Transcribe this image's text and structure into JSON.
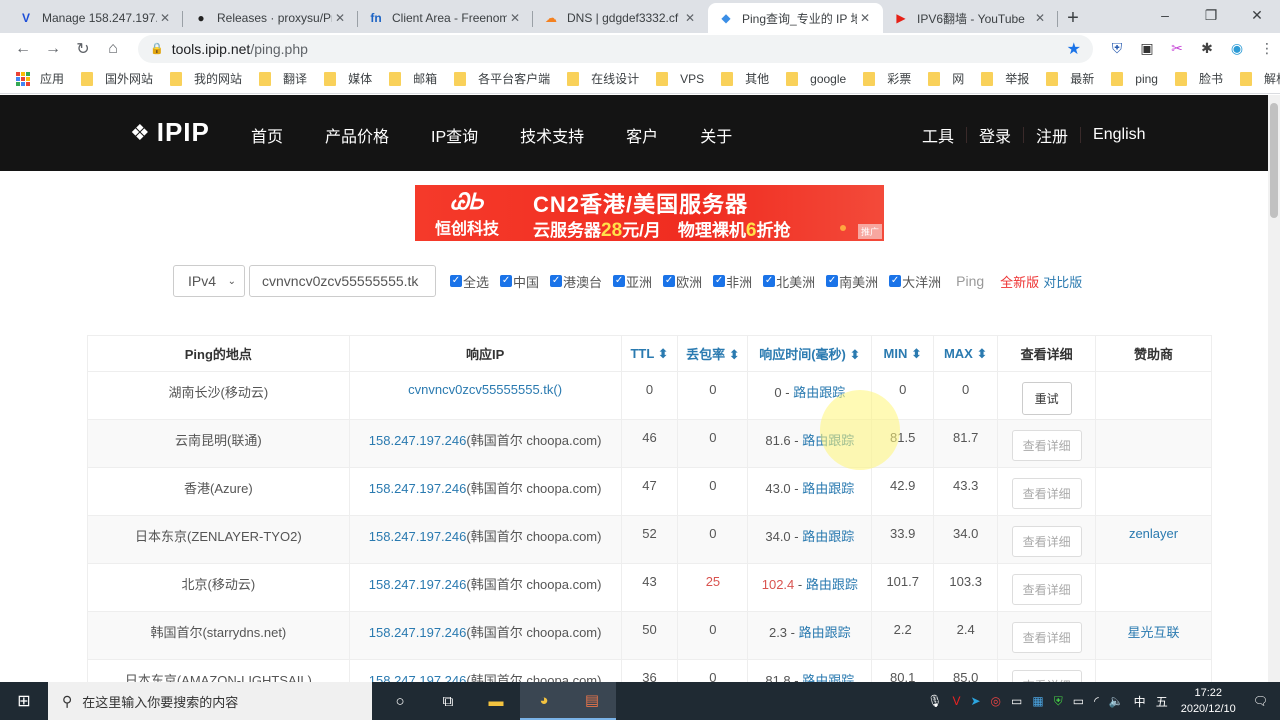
{
  "browser": {
    "tabs": [
      {
        "title": "Manage 158.247.197.",
        "icon": "vultr-icon",
        "glyph": "V",
        "color": "#1e4fd8",
        "active": false
      },
      {
        "title": "Releases · proxysu/Pr",
        "icon": "github-icon",
        "glyph": "●",
        "color": "#222",
        "active": false
      },
      {
        "title": "Client Area - Freenom",
        "icon": "freenom-icon",
        "glyph": "fn",
        "color": "#1c63c4",
        "active": false
      },
      {
        "title": "DNS | gdgdef3332.cf",
        "icon": "cloudflare-icon",
        "glyph": "☁",
        "color": "#f48120",
        "active": false
      },
      {
        "title": "Ping查询_专业的 IP 地",
        "icon": "ipip-icon",
        "glyph": "◆",
        "color": "#3a8ee6",
        "active": true
      },
      {
        "title": "IPV6翻墙 - YouTube",
        "icon": "youtube-icon",
        "glyph": "▶",
        "color": "#e62117",
        "active": false
      }
    ],
    "new_tab": "+",
    "window_controls": {
      "minimize": "–",
      "restore": "❐",
      "close": "✕"
    },
    "url_host": "tools.ipip.net",
    "url_path": "/ping.php",
    "bookmarks": [
      "应用",
      "国外网站",
      "我的网站",
      "翻译",
      "媒体",
      "邮箱",
      "各平台客户端",
      "在线设计",
      "VPS",
      "其他",
      "google",
      "彩票",
      "网",
      "举报",
      "最新",
      "ping",
      "脸书",
      "解析"
    ]
  },
  "site": {
    "logo": "IPIP",
    "nav": [
      "首页",
      "产品价格",
      "IP查询",
      "技术支持",
      "客户",
      "关于"
    ],
    "right_nav": [
      "工具",
      "登录",
      "注册",
      "English"
    ]
  },
  "banner": {
    "brand": "恒创科技",
    "headline": "CN2香港/美国服务器",
    "sub_prefix": "云服务器",
    "price": "28",
    "sub_mid": "元/月　物理裸机",
    "discount": "6",
    "sub_suffix": "折抢",
    "ad_tag": "推广"
  },
  "search": {
    "ip_version": "IPv4",
    "domain": "cvnvncv0zcv55555555.tk",
    "regions": [
      "全选",
      "中国",
      "港澳台",
      "亚洲",
      "欧洲",
      "非洲",
      "北美洲",
      "南美洲",
      "大洋洲"
    ],
    "ping_button": "Ping",
    "new_version": "全新版",
    "compare_version": "对比版"
  },
  "table": {
    "headers": [
      "Ping的地点",
      "响应IP",
      "TTL",
      "丢包率",
      "响应时间(毫秒)",
      "MIN",
      "MAX",
      "查看详细",
      "赞助商"
    ],
    "sort_mark": "⬍",
    "trace_label": "路由跟踪",
    "rows": [
      {
        "location": "湖南长沙(移动云)",
        "ip": "cvnvncv0zcv55555555.tk()",
        "ip_note": "",
        "ttl": "0",
        "loss": "0",
        "time": "0",
        "min": "0",
        "max": "0",
        "action": "重试",
        "sponsor": "",
        "warn": false
      },
      {
        "location": "云南昆明(联通)",
        "ip": "158.247.197.246",
        "ip_note": "(韩国首尔 choopa.com)",
        "ttl": "46",
        "loss": "0",
        "time": "81.6",
        "min": "81.5",
        "max": "81.7",
        "action": "查看详细",
        "sponsor": "",
        "warn": false
      },
      {
        "location": "香港(Azure)",
        "ip": "158.247.197.246",
        "ip_note": "(韩国首尔 choopa.com)",
        "ttl": "47",
        "loss": "0",
        "time": "43.0",
        "min": "42.9",
        "max": "43.3",
        "action": "查看详细",
        "sponsor": "",
        "warn": false
      },
      {
        "location": "日本东京(ZENLAYER-TYO2)",
        "ip": "158.247.197.246",
        "ip_note": "(韩国首尔 choopa.com)",
        "ttl": "52",
        "loss": "0",
        "time": "34.0",
        "min": "33.9",
        "max": "34.0",
        "action": "查看详细",
        "sponsor": "zenlayer",
        "warn": false
      },
      {
        "location": "北京(移动云)",
        "ip": "158.247.197.246",
        "ip_note": "(韩国首尔 choopa.com)",
        "ttl": "43",
        "loss": "25",
        "time": "102.4",
        "min": "101.7",
        "max": "103.3",
        "action": "查看详细",
        "sponsor": "",
        "warn": true
      },
      {
        "location": "韩国首尔(starrydns.net)",
        "ip": "158.247.197.246",
        "ip_note": "(韩国首尔 choopa.com)",
        "ttl": "50",
        "loss": "0",
        "time": "2.3",
        "min": "2.2",
        "max": "2.4",
        "action": "查看详细",
        "sponsor": "星光互联",
        "warn": false
      },
      {
        "location": "日本东京(AMAZON-LIGHTSAIL)",
        "ip": "158.247.197.246",
        "ip_note": "(韩国首尔 choopa.com)",
        "ttl": "36",
        "loss": "0",
        "time": "81.8",
        "min": "80.1",
        "max": "85.0",
        "action": "查看详细",
        "sponsor": "",
        "warn": false
      }
    ]
  },
  "taskbar": {
    "search_placeholder": "在这里输入你要搜索的内容",
    "ime": "中",
    "ime_mode": "五",
    "time": "17:22",
    "date": "2020/12/10"
  }
}
